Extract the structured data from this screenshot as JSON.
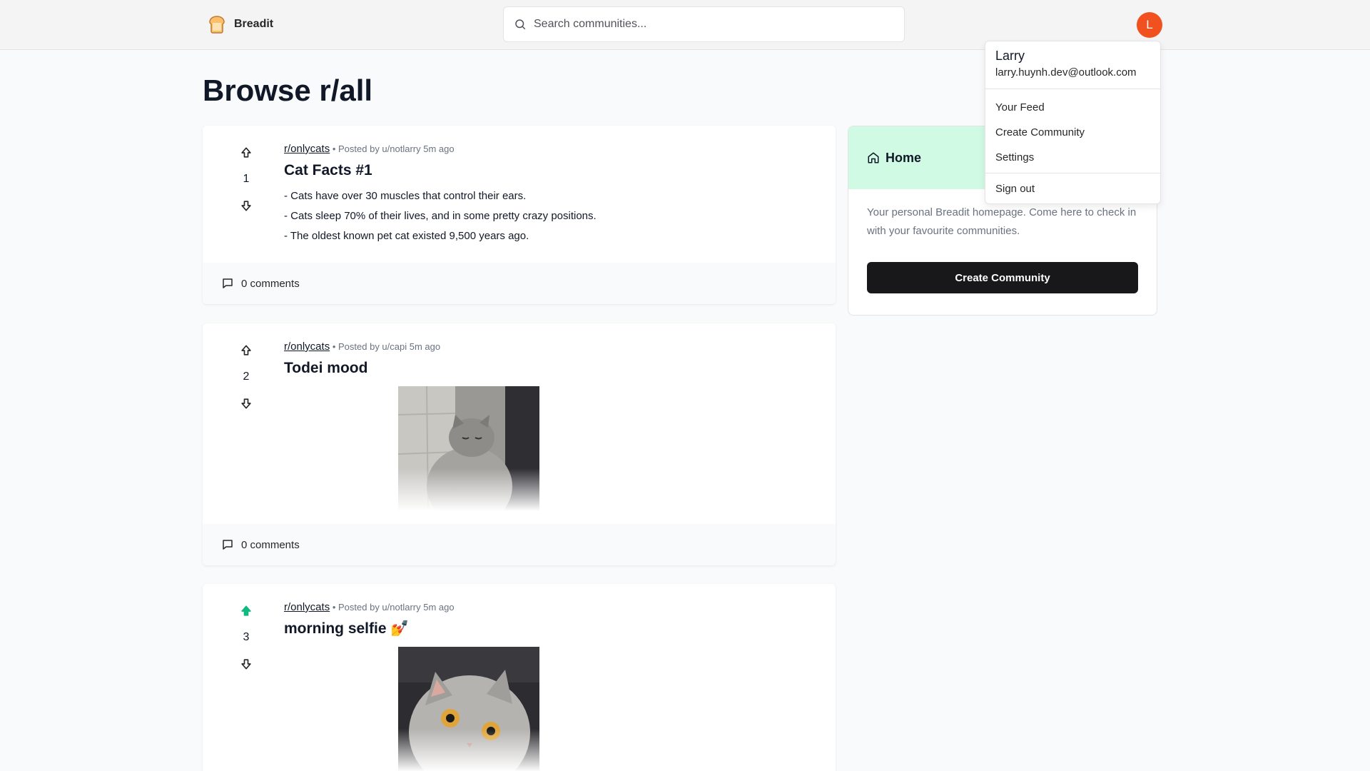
{
  "app": {
    "name": "Breadit"
  },
  "search": {
    "placeholder": "Search communities..."
  },
  "user": {
    "initial": "L",
    "name": "Larry",
    "email": "larry.huynh.dev@outlook.com"
  },
  "menu": {
    "items": [
      "Your Feed",
      "Create Community",
      "Settings"
    ],
    "sign_out": "Sign out"
  },
  "page": {
    "title": "Browse r/all"
  },
  "posts": [
    {
      "subreddit": "r/onlycats",
      "posted_by": "Posted by u/notlarry 5m ago",
      "votes": "1",
      "vote_state": "none",
      "title": "Cat Facts #1",
      "lines": [
        "- Cats have over 30 muscles that control their ears.",
        "- Cats sleep 70% of their lives, and in some pretty crazy positions.",
        "- The oldest known pet cat existed 9,500 years ago."
      ],
      "comments": "0 comments"
    },
    {
      "subreddit": "r/onlycats",
      "posted_by": "Posted by u/capi 5m ago",
      "votes": "2",
      "vote_state": "none",
      "title": "Todei mood",
      "comments": "0 comments"
    },
    {
      "subreddit": "r/onlycats",
      "posted_by": "Posted by u/notlarry 5m ago",
      "votes": "3",
      "vote_state": "up",
      "title": "morning selfie 💅"
    }
  ],
  "sidebar": {
    "title": "Home",
    "description": "Your personal Breadit homepage. Come here to check in with your favourite communities.",
    "button": "Create Community"
  },
  "colors": {
    "accent_up": "#10b981",
    "avatar": "#f0511e",
    "sidebar_head": "#d1fae5",
    "button": "#18181b"
  }
}
